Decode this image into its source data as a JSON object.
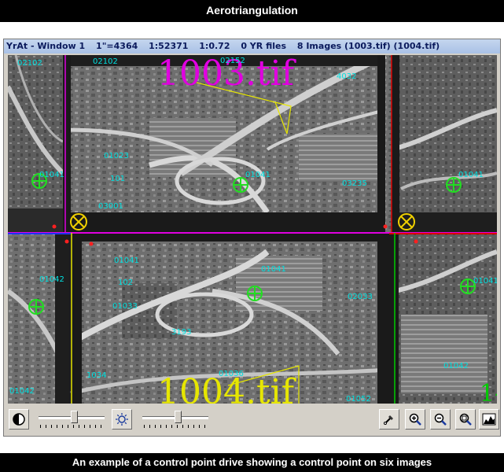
{
  "banner_top": "Aerotriangulation",
  "banner_bottom": "An example of a control point drive showing a control point on six images",
  "window": {
    "title": {
      "app": "YrAt - Window 1",
      "scale_inch": "1\"=4364",
      "scale_ratio": "1:52371",
      "zoom": "1:0.72",
      "yr_files": "0 YR files",
      "images": "8 Images (1003.tif) (1004.tif)"
    }
  },
  "overlays": {
    "big_label_top": "1003.tif",
    "big_label_bottom": "1004.tif",
    "side_label": "1-2",
    "points": {
      "p02102": "02102",
      "p02152": "02152",
      "p01041": "01041",
      "p01042": "01042",
      "p01023": "01023",
      "p01033": "01033",
      "p01052": "01052",
      "p03235": "03235",
      "p01036": "01036",
      "p02033": "02033",
      "p03001": "03001",
      "p3193": "3193",
      "p1034": "1034",
      "p101": "101",
      "p102": "102",
      "p4032": "4032"
    }
  },
  "toolbar": {
    "slider1_level": 0.55,
    "slider2_level": 0.55
  },
  "colors": {
    "control_point": "#22dd22",
    "check_point": "#f0d000",
    "label": "#00e0e0",
    "frame_yellow": "#e6e600",
    "frame_magenta": "#e000e0",
    "frame_red": "#dd0000",
    "frame_blue": "#2030ff",
    "frame_green": "#00cc00"
  },
  "icons": [
    "contrast-icon",
    "brightness-icon",
    "pick-color-icon",
    "zoom-in-icon",
    "zoom-out-icon",
    "zoom-fit-icon",
    "histogram-icon"
  ]
}
